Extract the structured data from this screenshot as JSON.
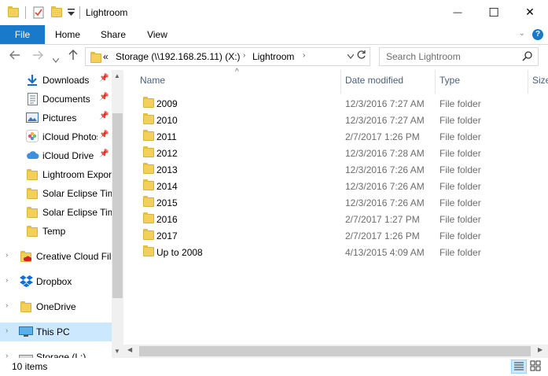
{
  "window": {
    "title": "Lightroom",
    "minimize": "—",
    "maximize": "☐",
    "close": "✕"
  },
  "ribbon": {
    "tabs": [
      {
        "label": "File"
      },
      {
        "label": "Home"
      },
      {
        "label": "Share"
      },
      {
        "label": "View"
      }
    ]
  },
  "address": {
    "overflow": "«",
    "crumbs": [
      "Storage (\\\\192.168.25.11) (X:)",
      "Lightroom"
    ]
  },
  "search": {
    "placeholder": "Search Lightroom"
  },
  "nav_pane": {
    "items": [
      {
        "label": "Downloads",
        "icon": "download-icon",
        "pinned": true
      },
      {
        "label": "Documents",
        "icon": "documents-icon",
        "pinned": true
      },
      {
        "label": "Pictures",
        "icon": "pictures-icon",
        "pinned": true
      },
      {
        "label": "iCloud Photos",
        "icon": "icloud-photos-icon",
        "pinned": true
      },
      {
        "label": "iCloud Drive",
        "icon": "icloud-drive-icon",
        "pinned": true
      },
      {
        "label": "Lightroom Exports",
        "icon": "folder-icon",
        "pinned": false
      },
      {
        "label": "Solar Eclipse Time",
        "icon": "folder-icon",
        "pinned": false
      },
      {
        "label": "Solar Eclipse Time",
        "icon": "folder-icon",
        "pinned": false
      },
      {
        "label": "Temp",
        "icon": "folder-icon",
        "pinned": false
      }
    ],
    "roots": [
      {
        "label": "Creative Cloud Files",
        "icon": "creative-cloud-icon",
        "selected": false
      },
      {
        "label": "Dropbox",
        "icon": "dropbox-icon",
        "selected": false
      },
      {
        "label": "OneDrive",
        "icon": "onedrive-icon",
        "selected": false
      },
      {
        "label": "This PC",
        "icon": "this-pc-icon",
        "selected": true
      },
      {
        "label": "Storage (L:)",
        "icon": "drive-icon",
        "selected": false
      }
    ]
  },
  "columns": {
    "name": "Name",
    "date": "Date modified",
    "type": "Type",
    "size": "Size"
  },
  "files": [
    {
      "name": "2009",
      "date": "12/3/2016 7:27 AM",
      "type": "File folder"
    },
    {
      "name": "2010",
      "date": "12/3/2016 7:27 AM",
      "type": "File folder"
    },
    {
      "name": "2011",
      "date": "2/7/2017 1:26 PM",
      "type": "File folder"
    },
    {
      "name": "2012",
      "date": "12/3/2016 7:28 AM",
      "type": "File folder"
    },
    {
      "name": "2013",
      "date": "12/3/2016 7:26 AM",
      "type": "File folder"
    },
    {
      "name": "2014",
      "date": "12/3/2016 7:26 AM",
      "type": "File folder"
    },
    {
      "name": "2015",
      "date": "12/3/2016 7:26 AM",
      "type": "File folder"
    },
    {
      "name": "2016",
      "date": "2/7/2017 1:27 PM",
      "type": "File folder"
    },
    {
      "name": "2017",
      "date": "2/7/2017 1:26 PM",
      "type": "File folder"
    },
    {
      "name": "Up to 2008",
      "date": "4/13/2015 4:09 AM",
      "type": "File folder"
    }
  ],
  "status": {
    "count": "10 items"
  },
  "colors": {
    "accent": "#1979ca",
    "folder": "#f3d05a",
    "selected": "#cce8ff"
  }
}
